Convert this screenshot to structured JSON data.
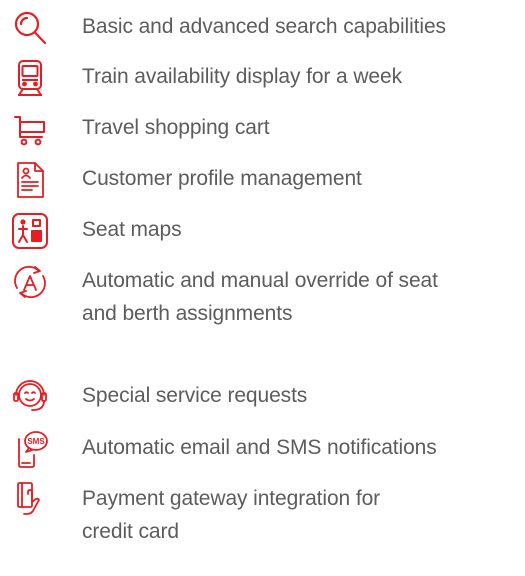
{
  "accent_color": "#e31e24",
  "text_color": "#5c5c5c",
  "features": [
    {
      "icon": "search-icon",
      "label": "Basic and advanced search capabilities"
    },
    {
      "icon": "train-icon",
      "label": "Train availability display for a week"
    },
    {
      "icon": "shopping-cart-icon",
      "label": "Travel shopping cart"
    },
    {
      "icon": "profile-document-icon",
      "label": "Customer profile management"
    },
    {
      "icon": "seat-map-icon",
      "label": "Seat maps"
    },
    {
      "icon": "seat-override-icon",
      "label": "Automatic and manual override of seat\nand berth assignments"
    },
    {
      "icon": "customer-service-headset-icon",
      "label": "Special service requests"
    },
    {
      "icon": "sms-notification-icon",
      "label": "Automatic email and SMS notifications"
    },
    {
      "icon": "payment-card-icon",
      "label": "Payment gateway integration for\ncredit card"
    }
  ]
}
